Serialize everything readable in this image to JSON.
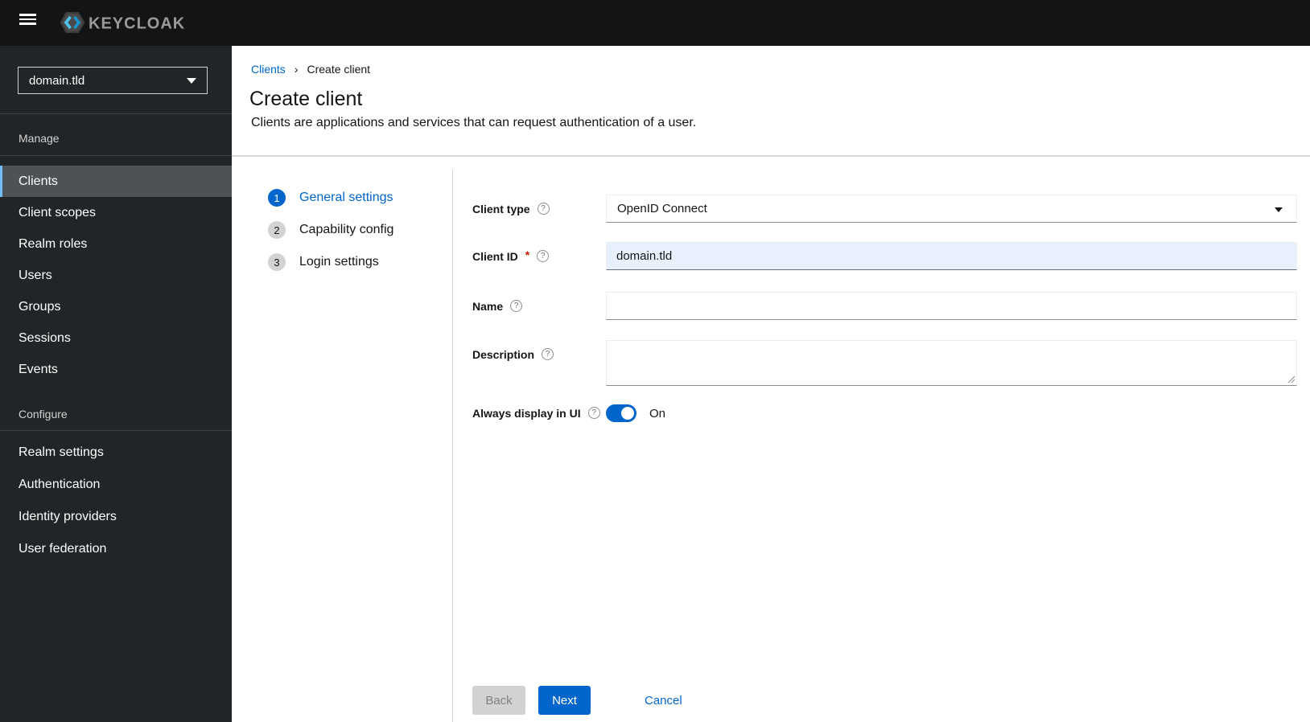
{
  "masthead": {
    "brand": "KEYCLOAK"
  },
  "sidebar": {
    "realm_selector": {
      "value": "domain.tld"
    },
    "sections": [
      {
        "title": "Manage",
        "items": [
          {
            "label": "Clients",
            "active": true
          },
          {
            "label": "Client scopes",
            "active": false
          },
          {
            "label": "Realm roles",
            "active": false
          },
          {
            "label": "Users",
            "active": false
          },
          {
            "label": "Groups",
            "active": false
          },
          {
            "label": "Sessions",
            "active": false
          },
          {
            "label": "Events",
            "active": false
          }
        ]
      },
      {
        "title": "Configure",
        "items": [
          {
            "label": "Realm settings",
            "active": false
          },
          {
            "label": "Authentication",
            "active": false
          },
          {
            "label": "Identity providers",
            "active": false
          },
          {
            "label": "User federation",
            "active": false
          }
        ]
      }
    ]
  },
  "breadcrumb": {
    "items": [
      "Clients",
      "Create client"
    ]
  },
  "page": {
    "title": "Create client",
    "subtitle": "Clients are applications and services that can request authentication of a user."
  },
  "wizard": {
    "steps": [
      {
        "num": "1",
        "label": "General settings",
        "active": true
      },
      {
        "num": "2",
        "label": "Capability config",
        "active": false
      },
      {
        "num": "3",
        "label": "Login settings",
        "active": false
      }
    ],
    "form": {
      "client_type": {
        "label": "Client type",
        "value": "OpenID Connect"
      },
      "client_id": {
        "label": "Client ID",
        "required_marker": "*",
        "value": "domain.tld"
      },
      "name": {
        "label": "Name",
        "value": ""
      },
      "description": {
        "label": "Description",
        "value": ""
      },
      "always_display": {
        "label": "Always display in UI",
        "state_label": "On",
        "enabled": true
      }
    },
    "footer": {
      "back_label": "Back",
      "next_label": "Next",
      "cancel_label": "Cancel"
    }
  },
  "icons": {
    "help_glyph": "?",
    "breadcrumb_separator": "›"
  },
  "colors": {
    "accent": "#0066cc",
    "masthead_bg": "#131415",
    "sidebar_bg": "#222527",
    "nav_selected_bg": "#4f5255",
    "nav_selected_border": "#73bcf7",
    "autofill_bg": "#e8f0fe",
    "disabled_button_bg": "#d2d2d2",
    "required_red": "#c9190b",
    "toggle_on": "#0066cc"
  }
}
